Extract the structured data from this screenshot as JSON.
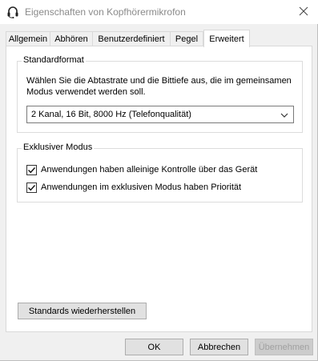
{
  "window": {
    "title": "Eigenschaften von Kopfhörermikrofon",
    "app_icon": "headset-icon",
    "close_icon": "close-icon"
  },
  "tabs": [
    {
      "label": "Allgemein",
      "active": false
    },
    {
      "label": "Abhören",
      "active": false
    },
    {
      "label": "Benutzerdefiniert",
      "active": false
    },
    {
      "label": "Pegel",
      "active": false
    },
    {
      "label": "Erweitert",
      "active": true
    }
  ],
  "standardformat": {
    "caption": "Standardformat",
    "description": "Wählen Sie die Abtastrate und die Bittiefe aus, die im gemeinsamen Modus verwendet werden soll.",
    "selected_format": "2 Kanal, 16 Bit, 8000 Hz (Telefonqualität)"
  },
  "exclusive_mode": {
    "caption": "Exklusiver Modus",
    "options": [
      {
        "label": "Anwendungen haben alleinige Kontrolle über das Gerät",
        "checked": true
      },
      {
        "label": "Anwendungen im exklusiven Modus haben Priorität",
        "checked": true
      }
    ]
  },
  "buttons": {
    "restore_defaults": "Standards wiederherstellen",
    "ok": "OK",
    "cancel": "Abbrechen",
    "apply": "Übernehmen"
  }
}
